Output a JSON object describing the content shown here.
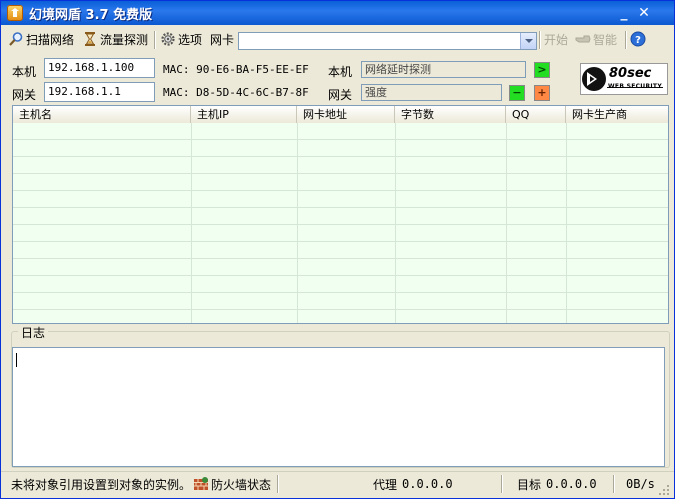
{
  "window": {
    "title": "幻境网盾 3.7 免费版",
    "minimize_glyph": "_",
    "close_glyph": "✕"
  },
  "toolbar": {
    "scan_label": "扫描网络",
    "traffic_label": "流量探测",
    "options_label": "选项",
    "nic_label": "网卡",
    "nic_value": "",
    "start_label": "开始",
    "smart_label": "智能"
  },
  "local": {
    "label": "本机",
    "ip": "192.168.1.100",
    "mac_prefix": "MAC:",
    "mac": "90-E6-BA-F5-EE-EF",
    "probe_label": "本机",
    "probe_text": "网络延时探测",
    "probe_btn": ">"
  },
  "gateway": {
    "label": "网关",
    "ip": "192.168.1.1",
    "mac_prefix": "MAC:",
    "mac": "D8-5D-4C-6C-B7-8F",
    "strength_label": "网关",
    "strength_text": "强度",
    "minus_btn": "−",
    "plus_btn": "+"
  },
  "logo": {
    "title": "80sec",
    "subtitle": "WEB SECURITY"
  },
  "table": {
    "columns": [
      "主机名",
      "主机IP",
      "网卡地址",
      "字节数",
      "QQ",
      "网卡生产商"
    ],
    "rows": []
  },
  "log": {
    "title": "日志",
    "content": ""
  },
  "status": {
    "message": "未将对象引用设置到对象的实例。",
    "firewall_label": "防火墙状态",
    "proxy_label": "代理",
    "proxy_value": "0.0.0.0",
    "target_label": "目标",
    "target_value": "0.0.0.0",
    "speed": "0B/s"
  },
  "colors": {
    "title_bar": "#0a5fd8",
    "row_bg": "#f0fff0",
    "go_button": "#22dd22",
    "plus_button": "#ff8844"
  }
}
